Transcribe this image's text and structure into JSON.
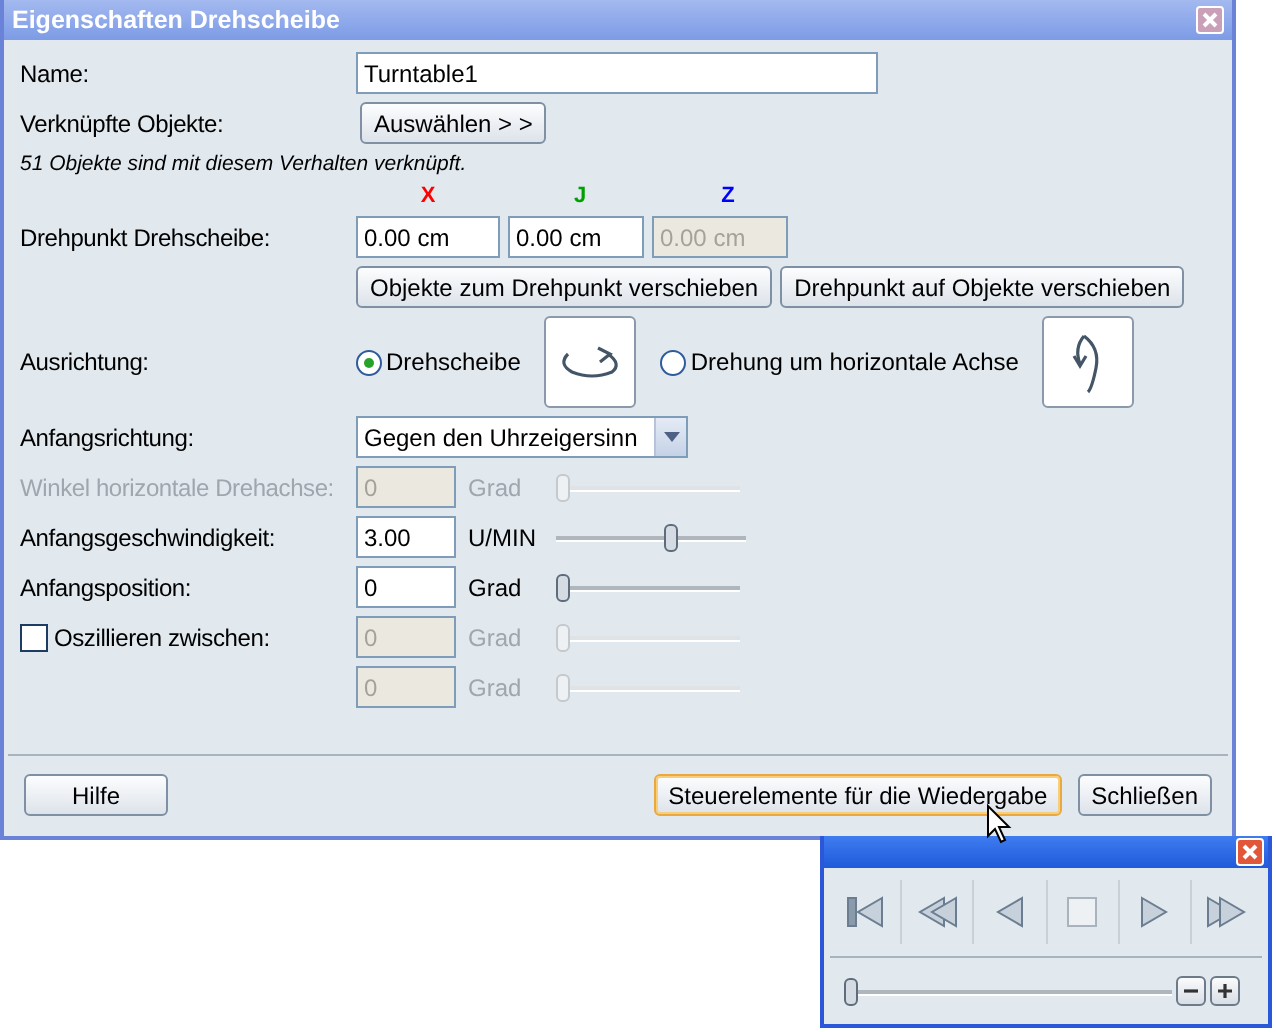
{
  "window": {
    "title": "Eigenschaften Drehscheibe"
  },
  "name": {
    "label": "Name:",
    "value": "Turntable1"
  },
  "linked": {
    "label": "Verknüpfte Objekte:",
    "button": "Auswählen > >"
  },
  "info": "51 Objekte sind mit diesem Verhalten verknüpft.",
  "pivot": {
    "label": "Drehpunkt Drehscheibe:",
    "axes": [
      {
        "label": "X",
        "color": "#ff0000",
        "value": "0.00 cm",
        "disabled": false
      },
      {
        "label": "J",
        "color": "#00a000",
        "value": "0.00 cm",
        "disabled": false
      },
      {
        "label": "Z",
        "color": "#0000ff",
        "value": "0.00 cm",
        "disabled": true
      }
    ],
    "buttons": [
      "Objekte zum Drehpunkt verschieben",
      "Drehpunkt auf Objekte verschieben"
    ]
  },
  "orientation": {
    "label": "Ausrichtung:",
    "options": [
      {
        "label": "Drehscheibe",
        "selected": true,
        "kind": "horizontal"
      },
      {
        "label": "Drehung um horizontale Achse",
        "selected": false,
        "kind": "vertical"
      }
    ]
  },
  "direction": {
    "label": "Anfangsrichtung:",
    "value": "Gegen den Uhrzeigersinn"
  },
  "rows": [
    {
      "kind": "label",
      "label": "Winkel horizontale Drehachse:",
      "value": "0",
      "unit": "Grad",
      "disabled": true,
      "level": 0
    },
    {
      "kind": "label",
      "label": "Anfangsgeschwindigkeit:",
      "value": "3.00",
      "unit": "U/MIN",
      "disabled": false,
      "level": 0.57
    },
    {
      "kind": "label",
      "label": "Anfangsposition:",
      "value": "0",
      "unit": "Grad",
      "disabled": false,
      "level": 0
    },
    {
      "kind": "checkbox",
      "label": "Oszillieren zwischen:",
      "checked": false,
      "value": "0",
      "unit": "Grad",
      "disabled": true,
      "level": 0
    },
    {
      "kind": "none",
      "value": "0",
      "unit": "Grad",
      "disabled": true,
      "level": 0
    }
  ],
  "footer": {
    "help": "Hilfe",
    "buttons": [
      {
        "label": "Steuerelemente für die Wiedergabe",
        "focused": true
      },
      {
        "label": "Schließen",
        "focused": false
      }
    ]
  },
  "playback": {
    "controls": [
      {
        "kind": "start"
      },
      {
        "kind": "rewind"
      },
      {
        "kind": "reverse"
      },
      {
        "kind": "stop"
      },
      {
        "kind": "play"
      },
      {
        "kind": "forward"
      }
    ],
    "level": 0
  }
}
